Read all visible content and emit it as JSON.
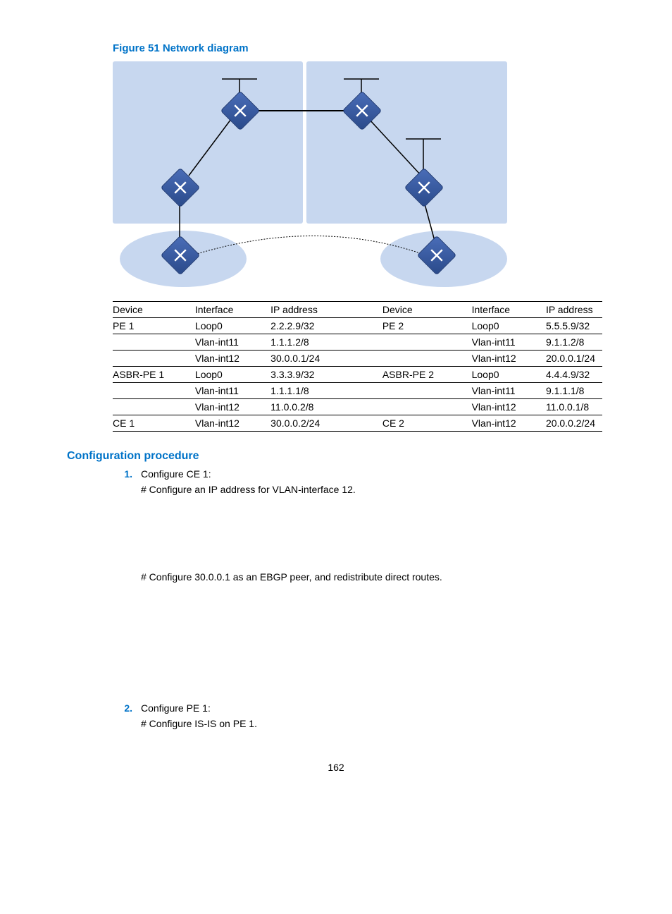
{
  "figure_title": "Figure 51 Network diagram",
  "table": {
    "headers": [
      "Device",
      "Interface",
      "IP address",
      "Device",
      "Interface",
      "IP address"
    ],
    "rows": [
      [
        "PE 1",
        "Loop0",
        "2.2.2.9/32",
        "PE 2",
        "Loop0",
        "5.5.5.9/32"
      ],
      [
        "",
        "Vlan-int11",
        "1.1.1.2/8",
        "",
        "Vlan-int11",
        "9.1.1.2/8"
      ],
      [
        "",
        "Vlan-int12",
        "30.0.0.1/24",
        "",
        "Vlan-int12",
        "20.0.0.1/24"
      ],
      [
        "ASBR-PE 1",
        "Loop0",
        "3.3.3.9/32",
        "ASBR-PE 2",
        "Loop0",
        "4.4.4.9/32"
      ],
      [
        "",
        "Vlan-int11",
        "1.1.1.1/8",
        "",
        "Vlan-int11",
        "9.1.1.1/8"
      ],
      [
        "",
        "Vlan-int12",
        "11.0.0.2/8",
        "",
        "Vlan-int12",
        "11.0.0.1/8"
      ],
      [
        "CE 1",
        "Vlan-int12",
        "30.0.0.2/24",
        "CE 2",
        "Vlan-int12",
        "20.0.0.2/24"
      ]
    ]
  },
  "section_title": "Configuration procedure",
  "steps": [
    {
      "num": "1.",
      "title": "Configure CE 1:",
      "lines": [
        "# Configure an IP address for VLAN-interface 12.",
        "# Configure 30.0.0.1 as an EBGP peer, and redistribute direct routes."
      ]
    },
    {
      "num": "2.",
      "title": "Configure PE 1:",
      "lines": [
        "# Configure IS-IS on PE 1."
      ]
    }
  ],
  "page_number": "162"
}
